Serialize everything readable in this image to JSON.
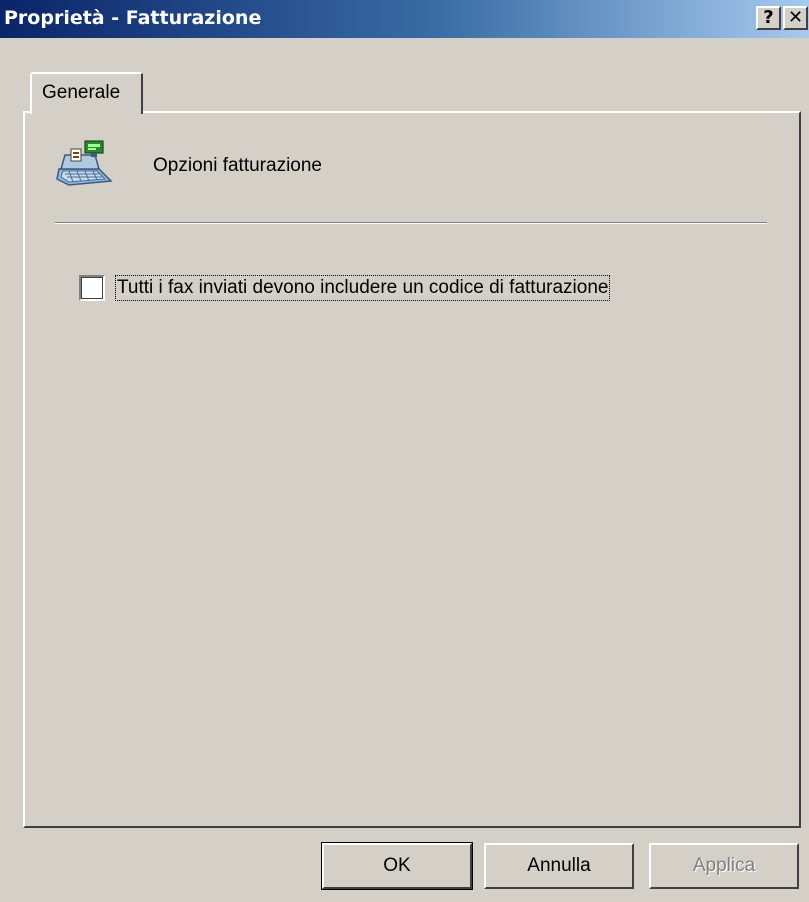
{
  "window": {
    "title": "Proprietà - Fatturazione",
    "help_label": "?",
    "close_label": "✕"
  },
  "tabs": [
    {
      "label": "Generale",
      "selected": true
    }
  ],
  "section": {
    "icon": "cash-register-icon",
    "title": "Opzioni fatturazione"
  },
  "options": {
    "billing_code_label": "Tutti i fax inviati devono includere un codice di fatturazione",
    "billing_code_checked": false
  },
  "buttons": {
    "ok": "OK",
    "cancel": "Annulla",
    "apply": "Applica"
  },
  "colors": {
    "face": "#d4d0c8",
    "title_start": "#0a246a",
    "title_end": "#a6caf0",
    "disabled_text": "#808080"
  }
}
